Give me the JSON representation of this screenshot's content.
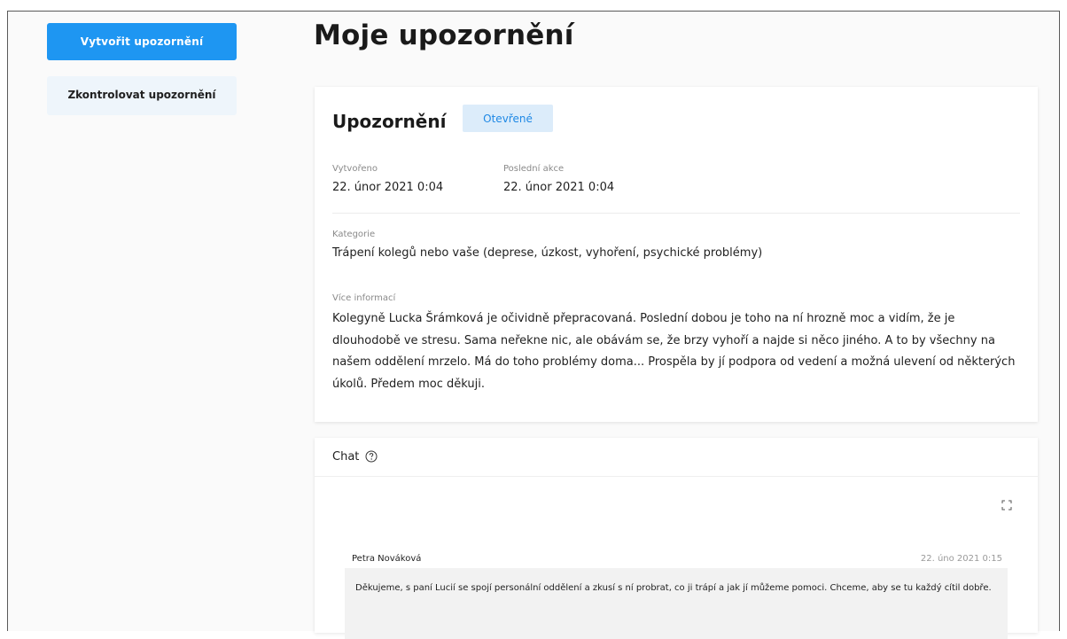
{
  "sidebar": {
    "create_label": "Vytvořit upozornění",
    "check_label": "Zkontrolovat upozornění"
  },
  "page": {
    "title": "Moje upozornění"
  },
  "alert": {
    "title": "Upozornění",
    "status": "Otevřené",
    "created_label": "Vytvořeno",
    "created_value": "22. únor 2021 0:04",
    "last_action_label": "Poslední akce",
    "last_action_value": "22. únor 2021 0:04",
    "category_label": "Kategorie",
    "category_value": "Trápení kolegů nebo vaše (deprese, úzkost, vyhoření, psychické problémy)",
    "more_info_label": "Více informací",
    "more_info_text": "Kolegyně Lucka Šrámková je očividně přepracovaná. Poslední dobou je toho na ní hrozně moc a vidím, že je dlouhodobě ve stresu. Sama neřekne nic, ale obávám se, že brzy vyhoří a najde si něco jiného. A to by všechny na našem oddělení mrzelo. Má do toho problémy doma... Prospěla by jí podpora od vedení a možná ulevení od některých úkolů. Předem moc děkuji."
  },
  "chat": {
    "title": "Chat",
    "messages": [
      {
        "author": "Petra Nováková",
        "time": "22. úno 2021 0:15",
        "text": "Děkujeme, s paní Lucií se spojí personální oddělení a zkusí s ní probrat, co ji trápí a jak jí můžeme pomoci. Chceme, aby se tu každý cítil dobře."
      }
    ]
  },
  "colors": {
    "primary": "#1e96f2",
    "badge_bg": "#dcecfa",
    "badge_text": "#1e88e5"
  },
  "icons": [
    "help-circle-icon",
    "expand-icon"
  ]
}
